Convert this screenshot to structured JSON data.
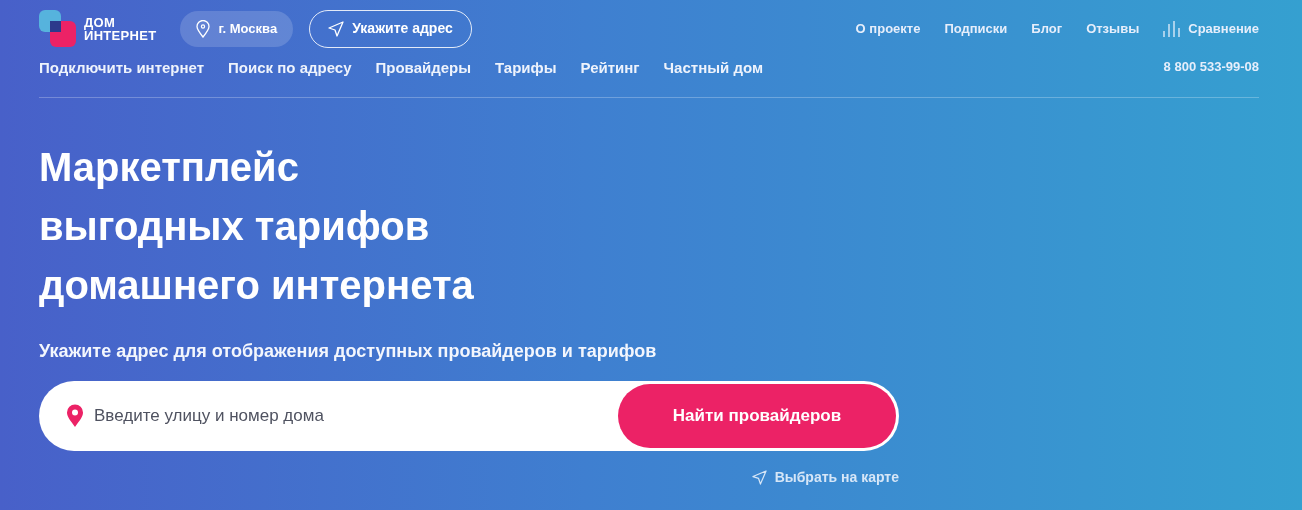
{
  "logo": {
    "line_1": "ДОМ",
    "line_2": "ИНТЕРНЕТ"
  },
  "city_button": "г. Москва",
  "address_button": "Укажите адрес",
  "top_links": [
    {
      "label": "О проекте",
      "kind": "link"
    },
    {
      "label": "Подписки",
      "kind": "link"
    },
    {
      "label": "Блог",
      "kind": "link"
    },
    {
      "label": "Отзывы",
      "kind": "link"
    },
    {
      "label": "Сравнение",
      "kind": "compare"
    }
  ],
  "main_nav": [
    "Подключить интернет",
    "Поиск по адресу",
    "Провайдеры",
    "Тарифы",
    "Рейтинг",
    "Частный дом"
  ],
  "phone": "8 800 533-99-08",
  "hero": {
    "title_lines": [
      "Маркетплейс",
      "выгодных тарифов",
      "домашнего интернета"
    ],
    "subtitle": "Укажите адрес для отображения доступных провайдеров и тарифов",
    "search": {
      "placeholder": "Введите улицу и номер дома",
      "button": "Найти провайдеров"
    },
    "map_link": "Выбрать на карте"
  }
}
